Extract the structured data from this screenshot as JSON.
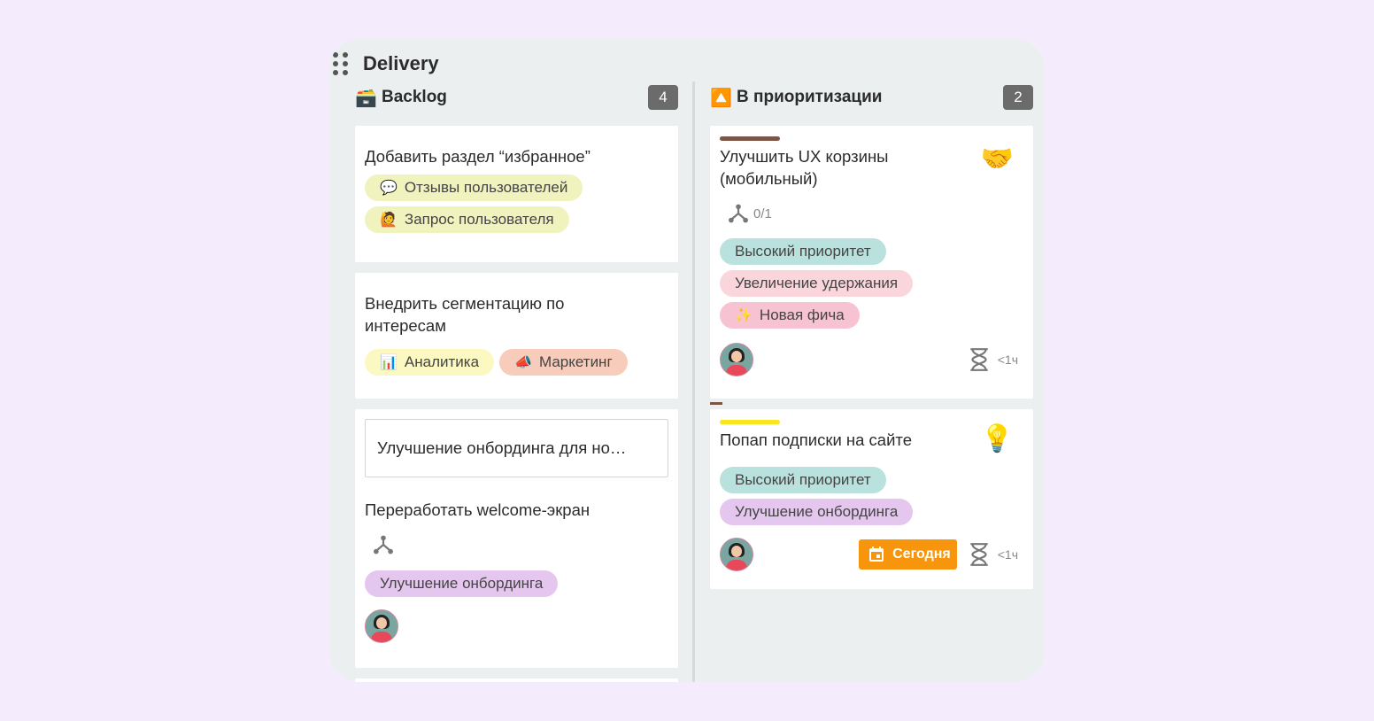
{
  "board": {
    "title": "Delivery"
  },
  "columns": [
    {
      "emoji": "🗃️",
      "title": "Backlog",
      "count": "4",
      "cards": [
        {
          "title": "Добавить раздел “избранное”",
          "tags": [
            {
              "emoji": "💬",
              "label": "Отзывы пользователей",
              "color": "#f1f3bf"
            },
            {
              "emoji": "🙋",
              "label": "Запрос пользователя",
              "color": "#f1f3bf"
            }
          ]
        },
        {
          "title": "Внедрить сегментацию по интересам",
          "tags": [
            {
              "emoji": "📊",
              "label": "Аналитика",
              "color": "#fbf8c2"
            },
            {
              "emoji": "📣",
              "label": "Маркетинг",
              "color": "#f8ccbb"
            }
          ]
        },
        {
          "parent": "Улучшение онбординга для но…",
          "title": "Переработать welcome-экран",
          "tags": [
            {
              "label": "Улучшение онбординга",
              "color": "#e4c6ee"
            }
          ]
        }
      ]
    },
    {
      "emoji": "🔼",
      "title": "В приоритизации",
      "count": "2",
      "cards": [
        {
          "title": "Улучшить UX корзины (мобильный)",
          "emoji": "🤝",
          "bar_color": "#7a5548",
          "subtasks": "0/1",
          "tags": [
            {
              "label": "Высокий приоритет",
              "color": "#b9e2de"
            },
            {
              "label": "Увеличение удержания",
              "color": "#fbd5dc"
            },
            {
              "emoji": "✨",
              "label": "Новая фича",
              "color": "#f7c2d1"
            }
          ],
          "estimate": "<1ч"
        },
        {
          "title": "Попап подписки на сайте",
          "emoji": "💡",
          "bar_color": "#f8e71c",
          "tags": [
            {
              "label": "Высокий приоритет",
              "color": "#b9e2de"
            },
            {
              "label": "Улучшение онбординга",
              "color": "#e4c6ee"
            }
          ],
          "due": "Сегодня",
          "estimate": "<1ч"
        }
      ]
    }
  ],
  "colors": {
    "background": "#f4ecfc",
    "board": "#ecefef",
    "count_badge": "#6b6b6b",
    "due_badge": "#f7960d"
  },
  "icons": [
    "drag-handle-icon",
    "subtask-icon",
    "hourglass-icon",
    "calendar-icon"
  ]
}
